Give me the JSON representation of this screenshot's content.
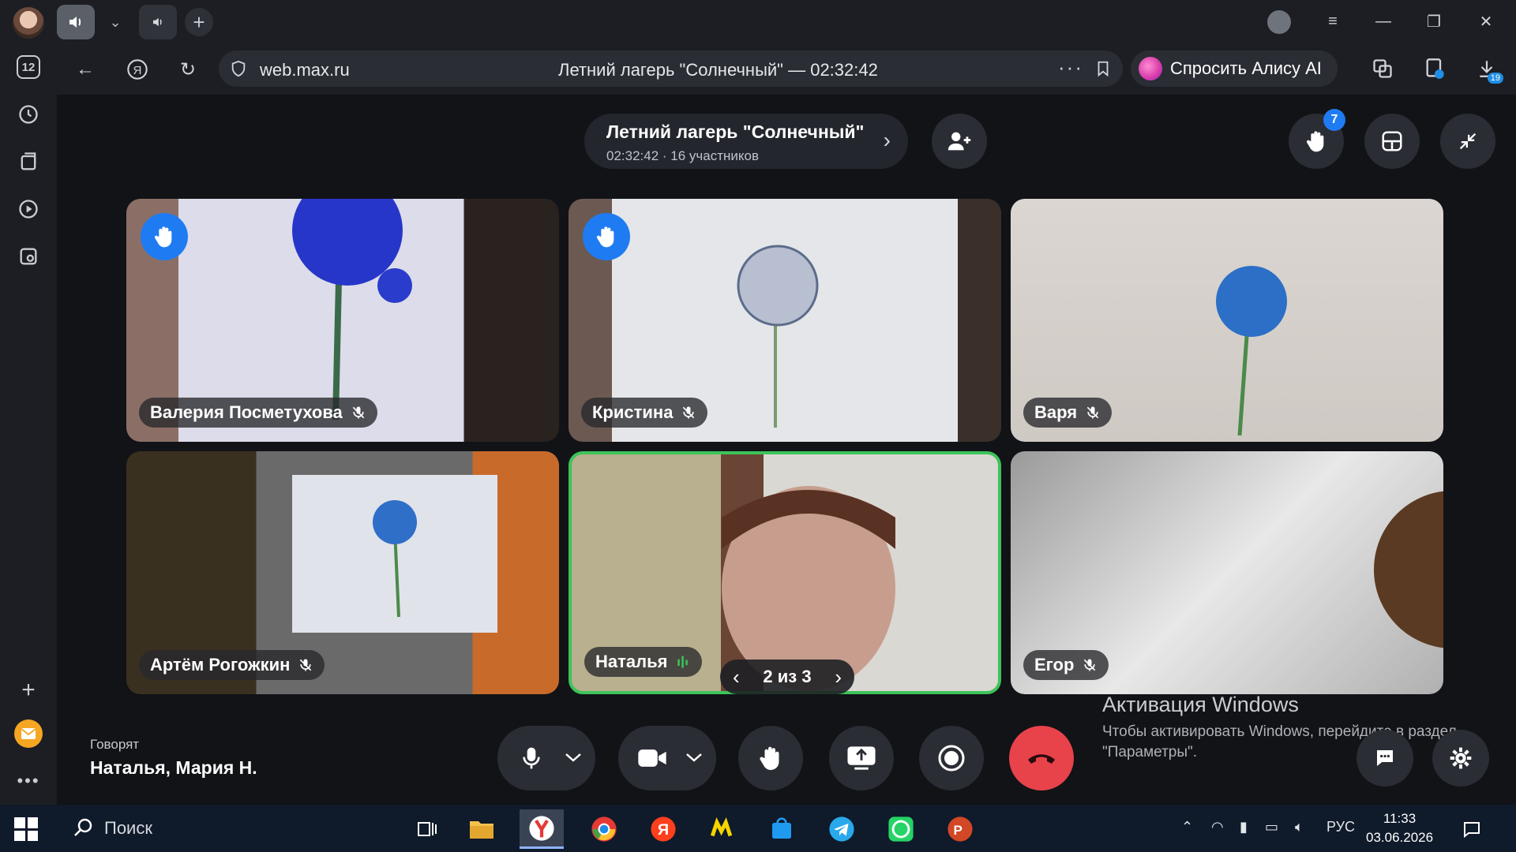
{
  "browser": {
    "url_host": "web.max.ru",
    "page_title": "Летний лагерь \"Солнечный\" — 02:32:42",
    "alice_button": "Спросить Алису AI",
    "sidebar_badge": "12",
    "downloads_badge": "19"
  },
  "meeting": {
    "title": "Летний лагерь \"Солнечный\"",
    "subtitle": "02:32:42 · 16 участников",
    "raised_hands_count": "7",
    "pager": "2 из 3",
    "speaking_label": "Говорят",
    "speaking_names": "Наталья, Мария Н.",
    "participants": [
      {
        "name": "Валерия Посметухова",
        "muted": true,
        "hand_raised": true,
        "speaking": false
      },
      {
        "name": "Кристина",
        "muted": true,
        "hand_raised": true,
        "speaking": false
      },
      {
        "name": "Варя",
        "muted": true,
        "hand_raised": false,
        "speaking": false
      },
      {
        "name": "Артём Рогожкин",
        "muted": true,
        "hand_raised": false,
        "speaking": false
      },
      {
        "name": "Наталья",
        "muted": false,
        "hand_raised": false,
        "speaking": true
      },
      {
        "name": "Егор",
        "muted": true,
        "hand_raised": false,
        "speaking": false
      }
    ]
  },
  "windows_activation": {
    "title": "Активация Windows",
    "text": "Чтобы активировать Windows, перейдите в раздел \"Параметры\"."
  },
  "taskbar": {
    "search_placeholder": "Поиск",
    "lang": "РУС",
    "time": "11:33",
    "date": "03.06.2026"
  },
  "colors": {
    "accent_blue": "#1f7bf2",
    "speaking_green": "#3dc35a",
    "end_call_red": "#e8424b"
  }
}
